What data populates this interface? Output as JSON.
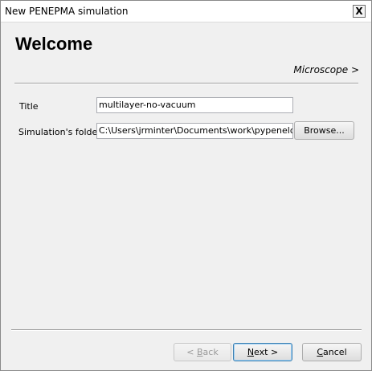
{
  "window": {
    "title": "New PENEPMA simulation",
    "close_glyph": "X"
  },
  "page": {
    "heading": "Welcome",
    "next_page_link": "Microscope >"
  },
  "form": {
    "title_label": "Title",
    "title_value": "multilayer-no-vacuum",
    "folder_label": "Simulation's folder",
    "folder_value": "C:\\Users\\jrminter\\Documents\\work\\pypenelope\\m",
    "browse_label": "Browse..."
  },
  "footer": {
    "back_prefix": "<",
    "back_mnemonic": "B",
    "back_rest": "ack",
    "next_mnemonic": "N",
    "next_rest": "ext >",
    "cancel_mnemonic": "C",
    "cancel_rest": "ancel",
    "back_enabled": false
  },
  "icons": {
    "close": "close-icon"
  }
}
